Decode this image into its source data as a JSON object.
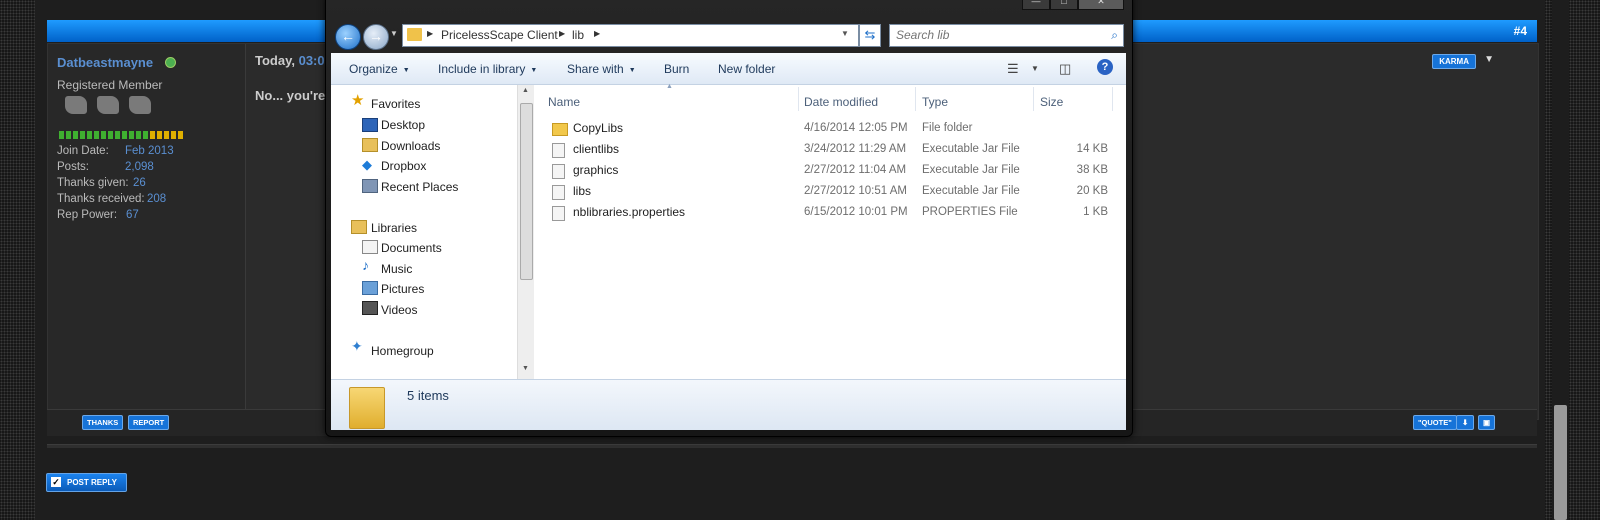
{
  "forum": {
    "post_number": "#4",
    "username": "Datbeastmayne",
    "user_title": "Registered Member",
    "stats": [
      {
        "label": "Join Date:",
        "value": "Feb 2013"
      },
      {
        "label": "Posts:",
        "value": "2,098"
      },
      {
        "label": "Thanks given:",
        "value": "26"
      },
      {
        "label": "Thanks received:",
        "value": "208"
      },
      {
        "label": "Rep Power:",
        "value": "67"
      }
    ],
    "post_date_prefix": "Today,",
    "post_date_time": "03:0",
    "post_text": "No... you're",
    "karma_label": "KARMA",
    "thanks_label": "THANKS",
    "report_label": "REPORT",
    "quote_label": "\"QUOTE\"",
    "post_reply_label": "POST REPLY",
    "rep_bar_colors": [
      "#3fb030",
      "#3fb030",
      "#3fb030",
      "#3fb030",
      "#3fb030",
      "#3fb030",
      "#3fb030",
      "#3fb030",
      "#3fb030",
      "#3fb030",
      "#3fb030",
      "#3fb030",
      "#3fb030",
      "#e0b000",
      "#e0b000",
      "#e0b000",
      "#e0b000",
      "#e0b000"
    ]
  },
  "explorer": {
    "breadcrumb": [
      "PricelessScape Client",
      "lib"
    ],
    "search_placeholder": "Search lib",
    "toolbar": {
      "organize": "Organize",
      "include_in_library": "Include in library",
      "share_with": "Share with",
      "burn": "Burn",
      "new_folder": "New folder"
    },
    "nav": {
      "favorites": "Favorites",
      "favorites_items": [
        "Desktop",
        "Downloads",
        "Dropbox",
        "Recent Places"
      ],
      "libraries": "Libraries",
      "libraries_items": [
        "Documents",
        "Music",
        "Pictures",
        "Videos"
      ],
      "homegroup": "Homegroup"
    },
    "columns": {
      "name": "Name",
      "date": "Date modified",
      "type": "Type",
      "size": "Size"
    },
    "files": [
      {
        "name": "CopyLibs",
        "date": "4/16/2014 12:05 PM",
        "type": "File folder",
        "size": "",
        "icon": "folder-icon"
      },
      {
        "name": "clientlibs",
        "date": "3/24/2012 11:29 AM",
        "type": "Executable Jar File",
        "size": "14 KB",
        "icon": "jar-file-icon"
      },
      {
        "name": "graphics",
        "date": "2/27/2012 11:04 AM",
        "type": "Executable Jar File",
        "size": "38 KB",
        "icon": "jar-file-icon"
      },
      {
        "name": "libs",
        "date": "2/27/2012 10:51 AM",
        "type": "Executable Jar File",
        "size": "20 KB",
        "icon": "jar-file-icon"
      },
      {
        "name": "nblibraries.properties",
        "date": "6/15/2012 10:01 PM",
        "type": "PROPERTIES File",
        "size": "1 KB",
        "icon": "file-icon"
      }
    ],
    "item_count": "5 items"
  }
}
